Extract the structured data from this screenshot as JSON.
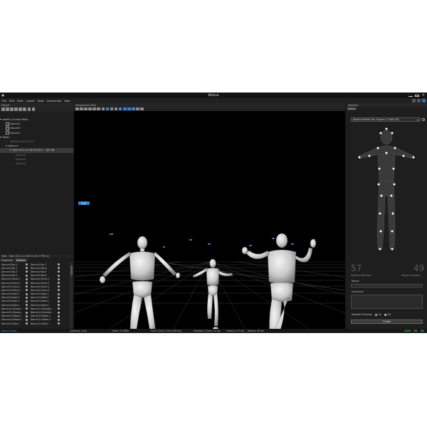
{
  "window": {
    "title": "Motive"
  },
  "menu": [
    "File",
    "Edit",
    "View",
    "Layout",
    "Tools",
    "Community",
    "Help"
  ],
  "project": {
    "header": "Project",
    "assets_label": "Assets (Current Take)",
    "assets": [
      "Dancer2",
      "Dancer3",
      "Dancer1"
    ],
    "takes_label": "Takes",
    "session": "Session 2012-12-15",
    "folder": "Apenum",
    "take_selected": "Take 2012-12-06 03.29.1...",
    "take_badges": [
      "2D",
      "3D"
    ],
    "take_items": [
      "Dancer2",
      "Dancer1",
      "Dancer3"
    ],
    "take_info": "Take : Take 2012-12-06 03.29.17 PM (2)"
  },
  "subtabs": [
    "Properties",
    "Markers"
  ],
  "markers": {
    "col1": [
      "Dancer2:Hip-1",
      "Dancer2:Hip-2",
      "Dancer2:Hip-3",
      "Dancer2:Hip-4",
      "Dancer2:Chest-1",
      "Dancer2:Chest-2",
      "Dancer2:Chest-3",
      "Dancer2:Chest-4",
      "Dancer2:Head-1",
      "Dancer2:Head-2",
      "Dancer2:Head-3",
      "Dancer2:Head-4",
      "Dancer2:LShould...",
      "Dancer2:LShould...",
      "Dancer2:LElbow-1",
      "Dancer2:LElbow-2",
      "Dancer2:LUArm..."
    ],
    "col2": [
      "Dancer2:Hip-7",
      "Dancer2:Hip-8",
      "Dancer2:Hip-9",
      "Dancer2:Hip-8",
      "Dancer2:Chest-1",
      "Dancer2:Chest-2",
      "Dancer2:Chest-3",
      "Dancer2:Chest-4",
      "Dancer1:Head-1",
      "Dancer1:Head-2",
      "Dancer1:Head-3",
      "Dancer1:Head-4",
      "Dancer1:LShoulde...",
      "Dancer1:LShoulde...",
      "Dancer1:LElbow-1",
      "Dancer1:LElbow-2",
      "Dancer1:LUArm..."
    ]
  },
  "viewport": {
    "header": "Perspective View",
    "edit_label": "EDIT"
  },
  "skeleton": {
    "header": "Skeleton",
    "tab": "Motive",
    "template": "Baseline Broken Toe, Fingers & Chest (46)",
    "markers_detected": "57",
    "markers_detected_label": "Markers Detected",
    "markers_needed": "49",
    "markers_needed_label": "Markers Needed",
    "name_label": "Name:",
    "comment_label": "Comment:",
    "preview_label": "Skeleton Preview:",
    "preview_on": "On",
    "preview_off": "Off",
    "create_label": "Create"
  },
  "status": {
    "left": "Status Panels",
    "cameras": "Cameras: 0 fps",
    "data": "Data: 0.0 KB/s",
    "point_cloud": "Point Cloud: 0.0ms (99 fps)",
    "skeleton": "Skeleton: 0.5ms 0.0 fps",
    "latency": "Latency: 0.0 ms",
    "deploy": "Deploy: 99 fps",
    "modes": [
      "CAM",
      "2D",
      "3D"
    ]
  },
  "colors": {
    "accent": "#2a7fd4",
    "mode_green": "#38c24a"
  },
  "icons": [
    "folder-open-icon",
    "save-icon",
    "record-icon",
    "camera-icon",
    "grid-icon",
    "gear-icon"
  ]
}
